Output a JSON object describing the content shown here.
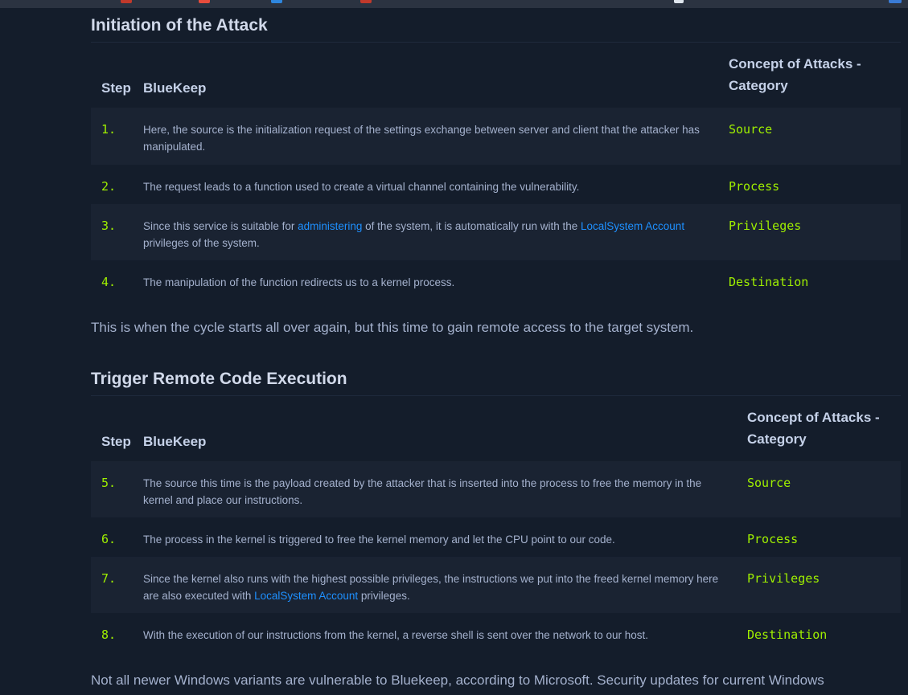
{
  "section1": {
    "heading": "Initiation of the Attack",
    "headers": {
      "step": "Step",
      "bluekeep": "BlueKeep",
      "category": "Concept of Attacks - Category"
    },
    "rows": [
      {
        "step": "1.",
        "text_before": "Here, the source is the initialization request of the settings exchange between server and client that the attacker has manipulated.",
        "category": "Source"
      },
      {
        "step": "2.",
        "text_before": "The request leads to a function used to create a virtual channel containing the vulnerability.",
        "category": "Process"
      },
      {
        "step": "3.",
        "text_before": "Since this service is suitable for ",
        "link1": "administering",
        "text_mid": " of the system, it is automatically run with the ",
        "link2": "LocalSystem Account",
        "text_after": " privileges of the system.",
        "category": "Privileges"
      },
      {
        "step": "4.",
        "text_before": "The manipulation of the function redirects us to a kernel process.",
        "category": "Destination"
      }
    ]
  },
  "paragraph1": "This is when the cycle starts all over again, but this time to gain remote access to the target system.",
  "section2": {
    "heading": "Trigger Remote Code Execution",
    "headers": {
      "step": "Step",
      "bluekeep": "BlueKeep",
      "category": "Concept of Attacks - Category"
    },
    "rows": [
      {
        "step": "5.",
        "text_before": "The source this time is the payload created by the attacker that is inserted into the process to free the memory in the kernel and place our instructions.",
        "category": "Source"
      },
      {
        "step": "6.",
        "text_before": "The process in the kernel is triggered to free the kernel memory and let the CPU point to our code.",
        "category": "Process"
      },
      {
        "step": "7.",
        "text_before": "Since the kernel also runs with the highest possible privileges, the instructions we put into the freed kernel memory here are also executed with ",
        "link1": "LocalSystem Account",
        "text_after": " privileges.",
        "category": "Privileges"
      },
      {
        "step": "8.",
        "text_before": "With the execution of our instructions from the kernel, a reverse shell is sent over the network to our host.",
        "category": "Destination"
      }
    ]
  },
  "paragraph2": "Not all newer Windows variants are vulnerable to Bluekeep, according to Microsoft. Security updates for current Windows",
  "colors": {
    "background": "#141d2b",
    "accent": "#9fef00",
    "link": "#1e90ff",
    "heading": "#d1d9ea"
  }
}
